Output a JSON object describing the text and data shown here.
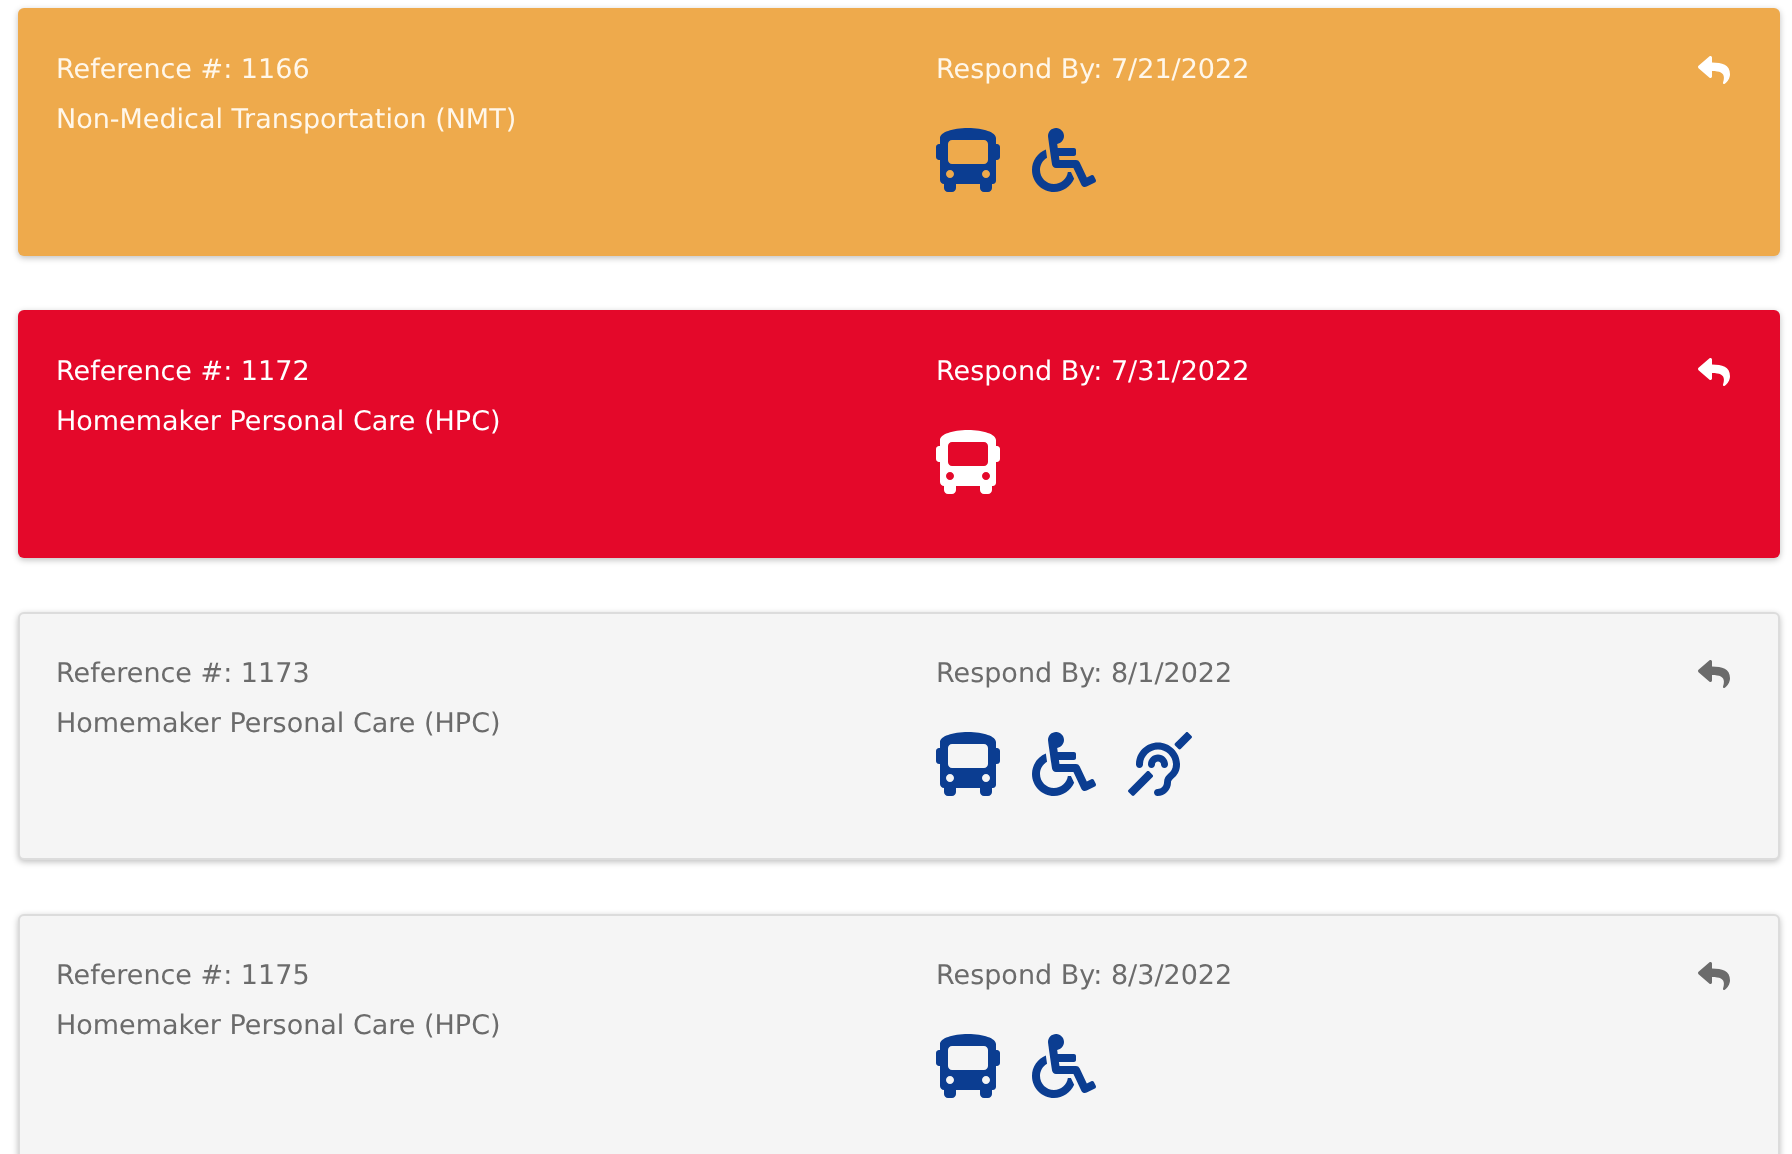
{
  "cards": [
    {
      "kind": "warning",
      "reference": "Reference #: 1166",
      "service": "Non-Medical Transportation (NMT)",
      "respond_by": "Respond By: 7/21/2022",
      "icons": [
        {
          "kind": "bus"
        },
        {
          "kind": "wheelchair"
        }
      ]
    },
    {
      "kind": "urgent",
      "reference": "Reference #: 1172",
      "service": "Homemaker Personal Care (HPC)",
      "respond_by": "Respond By: 7/31/2022",
      "icons": [
        {
          "kind": "bus"
        }
      ]
    },
    {
      "kind": "normal",
      "reference": "Reference #: 1173",
      "service": "Homemaker Personal Care (HPC)",
      "respond_by": "Respond By: 8/1/2022",
      "icons": [
        {
          "kind": "bus"
        },
        {
          "kind": "wheelchair"
        },
        {
          "kind": "hearing"
        }
      ]
    },
    {
      "kind": "normal",
      "reference": "Reference #: 1175",
      "service": "Homemaker Personal Care (HPC)",
      "respond_by": "Respond By: 8/3/2022",
      "icons": [
        {
          "kind": "bus"
        },
        {
          "kind": "wheelchair"
        }
      ]
    }
  ]
}
